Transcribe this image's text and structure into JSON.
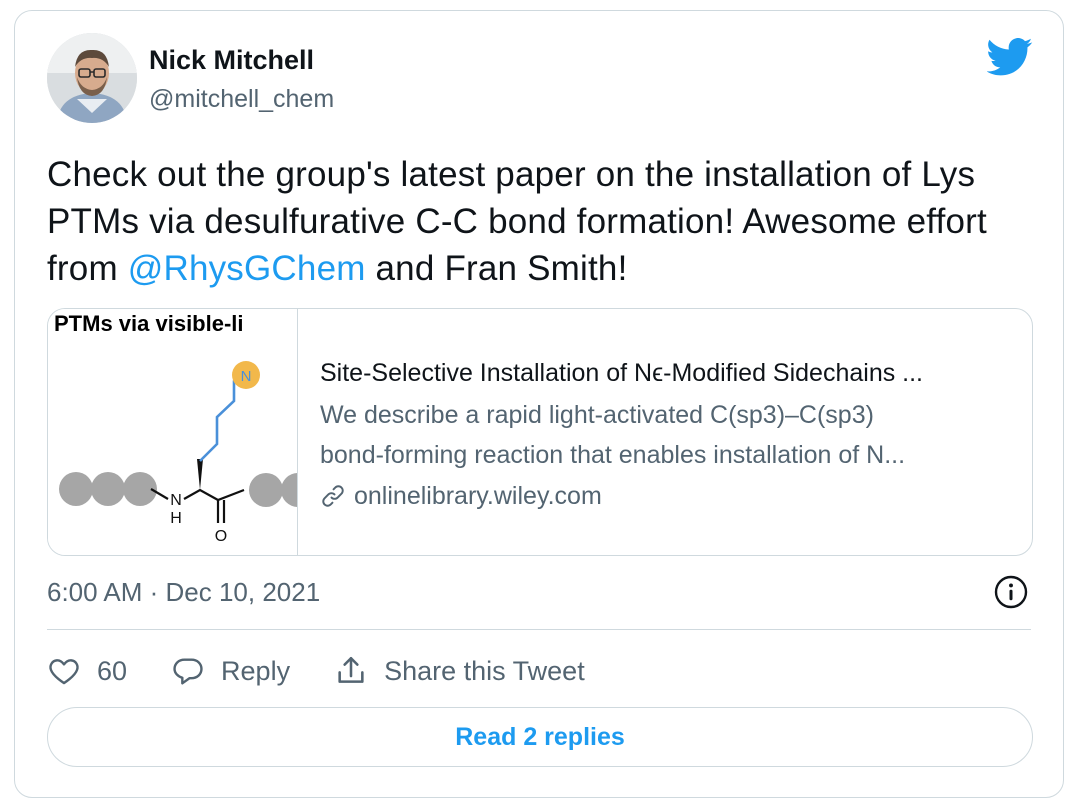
{
  "author": {
    "name": "Nick Mitchell",
    "handle": "@mitchell_chem"
  },
  "tweet": {
    "text_part1": "Check out the group's latest paper on the installation of Lys PTMs via desulfurative C-C bond formation! Awesome effort from ",
    "mention": "@RhysGChem",
    "text_part2": " and Fran Smith!"
  },
  "link_card": {
    "thumbnail_heading": "PTMs via visible-li",
    "thumbnail_atom_labels": {
      "n": "N",
      "nh_n": "N",
      "nh_h": "H",
      "o": "O"
    },
    "title": "Site-Selective Installation of Nϵ-Modified Sidechains ...",
    "description_line1": "We describe a rapid light-activated C(sp3)–C(sp3)",
    "description_line2": "bond-forming reaction that enables installation of N...",
    "domain": "onlinelibrary.wiley.com"
  },
  "timestamp": "6:00 AM · Dec 10, 2021",
  "actions": {
    "like_count": "60",
    "reply_label": "Reply",
    "share_label": "Share this Tweet"
  },
  "read_replies_label": "Read 2 replies",
  "icons": {
    "logo": "twitter-bird-icon",
    "info": "info-icon",
    "like": "heart-icon",
    "reply": "speech-bubble-icon",
    "share": "share-icon",
    "link": "link-icon"
  },
  "colors": {
    "accent": "#1d9bf0",
    "text": "#0f1419",
    "secondary": "#536471",
    "border": "#cfd9de"
  }
}
